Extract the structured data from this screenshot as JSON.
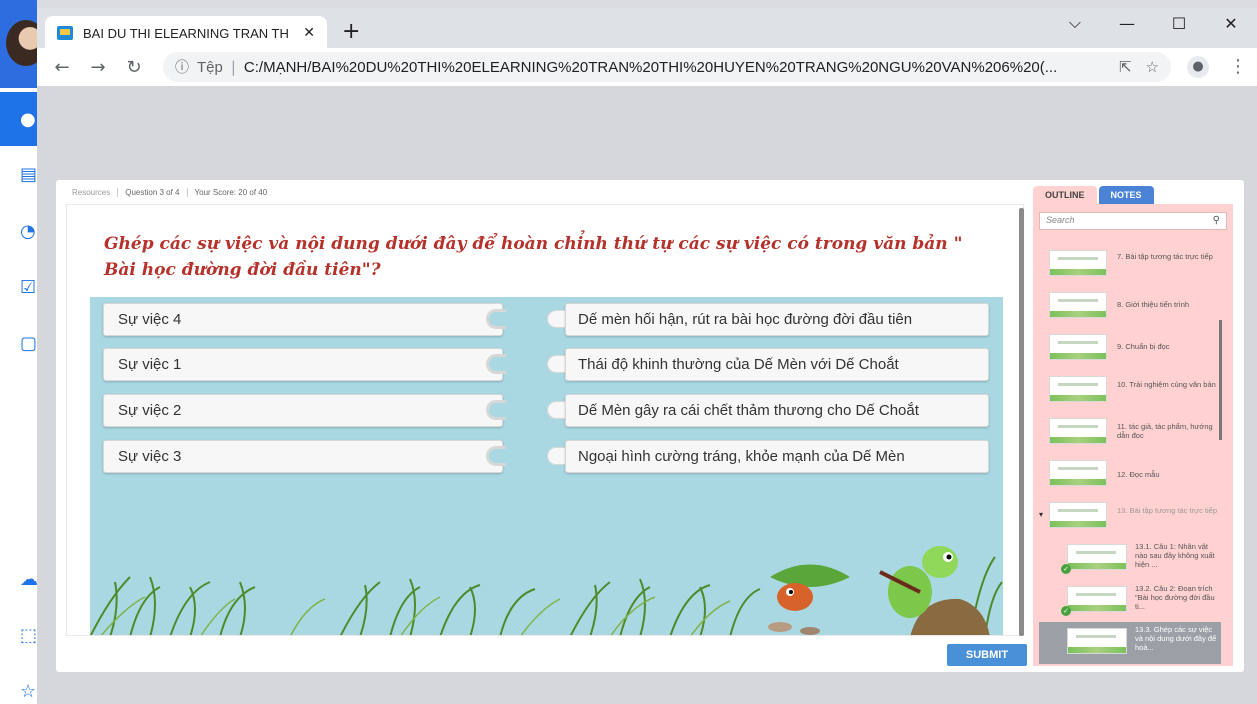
{
  "browser": {
    "tab_title": "BAI DU THI ELEARNING TRAN TH",
    "tab_close": "✕",
    "new_tab": "+",
    "info_icon": "ⓘ",
    "protocol_label": "Tệp",
    "separator": "|",
    "url": "C:/MẠNH/BAI%20DU%20THI%20ELEARNING%20TRAN%20THI%20HUYEN%20TRANG%20NGU%20VAN%206%20(...",
    "controls": {
      "minimize": "—",
      "maximize": "☐",
      "close": "✕",
      "dropdown": "⌵"
    }
  },
  "player": {
    "meta": {
      "resources": "Resources",
      "question": "Question 3 of 4",
      "score": "Your Score: 20 of 40"
    },
    "question": "Ghép các sự việc và nội dung dưới đây để hoàn chỉnh thứ tự các sự việc có trong văn bản \" Bài học đường đời đầu tiên\"?",
    "pairs": [
      {
        "left": "Sự việc 4",
        "right": "Dế mèn hối hận, rút ra bài học đường đời đầu tiên"
      },
      {
        "left": "Sự việc 1",
        "right": "Thái độ khinh thường của Dế Mèn với Dế Choắt"
      },
      {
        "left": "Sự việc 2",
        "right": "Dế Mèn gây ra cái chết thảm thương cho Dế Choắt"
      },
      {
        "left": "Sự việc 3",
        "right": "Ngoại hình cường tráng, khỏe mạnh của Dế Mèn"
      }
    ],
    "submit": "SUBMIT"
  },
  "sidebar": {
    "tabs": [
      "OUTLINE",
      "NOTES"
    ],
    "search_placeholder": "Search",
    "items": [
      {
        "label": "7. Bài tập tương tác trực tiếp"
      },
      {
        "label": "8. Giới thiệu tiến trình"
      },
      {
        "label": "9. Chuẩn bị đọc"
      },
      {
        "label": "10. Trải nghiệm cùng văn bản"
      },
      {
        "label": "11. tác giả, tác phẩm, hướng dẫn đọc"
      },
      {
        "label": "12. Đọc mẫu"
      },
      {
        "label": "13. Bài tập tương tác trực tiếp"
      },
      {
        "label": "13.1. Câu 1: Nhân vật nào sau đây không xuất hiện ..."
      },
      {
        "label": "13.2. Câu 2: Đoạn trích \"Bài học đường đời đầu ti..."
      },
      {
        "label": "13.3. Ghép các sự việc và nội dung dưới đây để hoà..."
      }
    ]
  },
  "colors": {
    "question": "#b5312a",
    "board": "#a9d8e2",
    "outline_panel": "#ffd1d1",
    "notes_tab": "#4a83d6",
    "submit": "#4a90d9"
  }
}
